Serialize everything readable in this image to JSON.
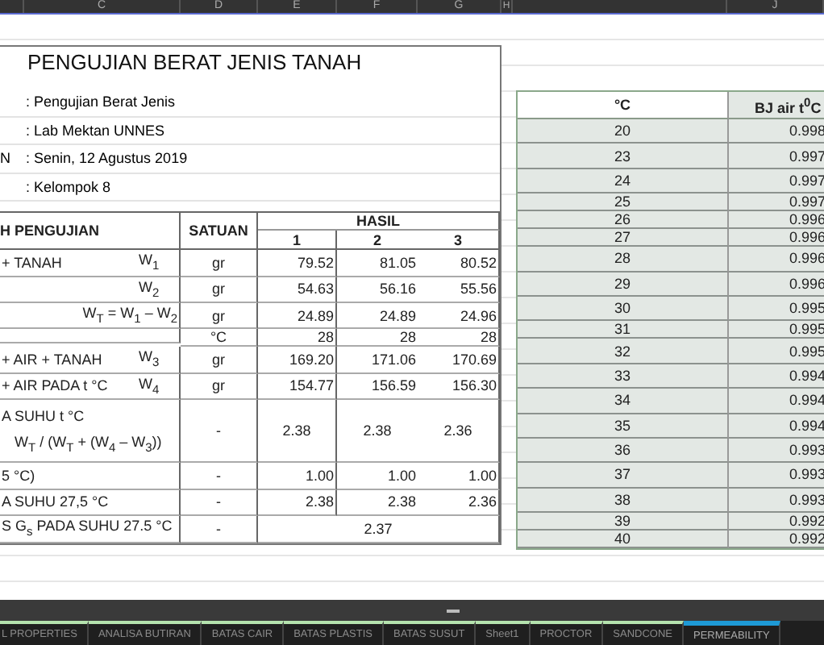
{
  "column_headers": [
    "C",
    "D",
    "E",
    "F",
    "G",
    "H",
    "J"
  ],
  "title": "PENGUJIAN BERAT JENIS TANAH",
  "info": [
    {
      "value": ": Pengujian Berat Jenis"
    },
    {
      "value": ": Lab Mektan UNNES"
    },
    {
      "label": "N",
      "value": ": Senin, 12 Agustus 2019"
    },
    {
      "value": ": Kelompok 8"
    }
  ],
  "test_table": {
    "headers": {
      "step": "H PENGUJIAN",
      "unit": "SATUAN",
      "result": "HASIL",
      "trials": [
        "1",
        "2",
        "3"
      ]
    },
    "rows": [
      {
        "kind": "measure",
        "label": "+ TANAH",
        "symbol": "W$_{1}$",
        "unit": "gr",
        "values": [
          "79.52",
          "81.05",
          "80.52"
        ]
      },
      {
        "kind": "measure",
        "symbol": "W$_{2}$",
        "unit": "gr",
        "values": [
          "54.63",
          "56.16",
          "55.56"
        ]
      },
      {
        "kind": "formula",
        "formula": "W$_{T}$ = W$_{1}$ – W$_{2}$",
        "unit": "gr",
        "values": [
          "24.89",
          "24.89",
          "24.96"
        ]
      },
      {
        "kind": "thin",
        "unit": "°C",
        "values": [
          "28",
          "28",
          "28"
        ]
      },
      {
        "kind": "measure",
        "label": "+ AIR + TANAH",
        "symbol": "W$_{3}$",
        "unit": "gr",
        "values": [
          "169.20",
          "171.06",
          "170.69"
        ]
      },
      {
        "kind": "measure",
        "label": "+ AIR PADA t °C",
        "symbol": "W$_{4}$",
        "unit": "gr",
        "values": [
          "154.77",
          "156.59",
          "156.30"
        ]
      },
      {
        "kind": "result",
        "label": "A SUHU t °C",
        "formula": "W$_{T}$ / (W$_{T}$ + (W$_{4}$ – W$_{3}$))",
        "unit": "-",
        "values": [
          "2.38",
          "2.38",
          "2.36"
        ]
      },
      {
        "kind": "measure",
        "label": "5 °C)",
        "unit": "-",
        "values": [
          "1.00",
          "1.00",
          "1.00"
        ]
      },
      {
        "kind": "measure",
        "label": "A SUHU 27,5 °C",
        "unit": "-",
        "values": [
          "2.38",
          "2.38",
          "2.36"
        ]
      },
      {
        "kind": "average",
        "label": "S G$_{s}$ PADA SUHU 27.5 °C",
        "unit": "-",
        "values": [
          "2.37"
        ]
      }
    ]
  },
  "water_table": {
    "headers": [
      "°C",
      "BJ air t$^{0}$C"
    ],
    "rows": [
      {
        "kind": "tall",
        "temp": "20",
        "density": "0.998"
      },
      {
        "kind": "tall",
        "temp": "23",
        "density": "0.997"
      },
      {
        "kind": "tall",
        "temp": "24",
        "density": "0.997"
      },
      {
        "kind": "short",
        "temp": "25",
        "density": "0.997"
      },
      {
        "kind": "short",
        "temp": "26",
        "density": "0.996"
      },
      {
        "kind": "short",
        "temp": "27",
        "density": "0.996"
      },
      {
        "kind": "tall",
        "temp": "28",
        "density": "0.996"
      },
      {
        "kind": "tall",
        "temp": "29",
        "density": "0.996"
      },
      {
        "kind": "tall",
        "temp": "30",
        "density": "0.995"
      },
      {
        "kind": "short",
        "temp": "31",
        "density": "0.995"
      },
      {
        "kind": "tall",
        "temp": "32",
        "density": "0.995"
      },
      {
        "kind": "tall",
        "temp": "33",
        "density": "0.994"
      },
      {
        "kind": "tall",
        "temp": "34",
        "density": "0.994"
      },
      {
        "kind": "tall",
        "temp": "35",
        "density": "0.994"
      },
      {
        "kind": "tall",
        "temp": "36",
        "density": "0.993"
      },
      {
        "kind": "tall",
        "temp": "37",
        "density": "0.993"
      },
      {
        "kind": "tall",
        "temp": "38",
        "density": "0.993"
      },
      {
        "kind": "short",
        "temp": "39",
        "density": "0.992"
      },
      {
        "kind": "short",
        "temp": "40",
        "density": "0.992"
      }
    ]
  },
  "sheet_tabs": [
    {
      "label": "L PROPERTIES",
      "selected": false,
      "color": "#b5e3ae"
    },
    {
      "label": "ANALISA BUTIRAN",
      "selected": false,
      "color": "#b5e3ae"
    },
    {
      "label": "BATAS CAIR",
      "selected": false,
      "color": "#b5e3ae"
    },
    {
      "label": "BATAS PLASTIS",
      "selected": false,
      "color": "#b5e3ae"
    },
    {
      "label": "BATAS SUSUT",
      "selected": false,
      "color": "#b5e3ae"
    },
    {
      "label": "Sheet1",
      "selected": false,
      "color": "#b5e3ae"
    },
    {
      "label": "PROCTOR",
      "selected": false,
      "color": "#b5e3ae"
    },
    {
      "label": "SANDCONE",
      "selected": false,
      "color": "#b5e3ae"
    },
    {
      "label": "PERMEABILITY",
      "selected": true,
      "color": "#1e9ad6"
    }
  ]
}
